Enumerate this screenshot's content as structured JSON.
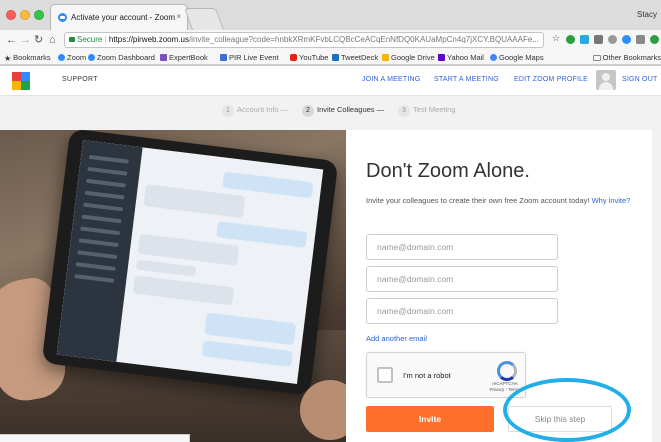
{
  "browser": {
    "tab_title": "Activate your account - Zoom",
    "tab_close": "×",
    "profile_name": "Stacy",
    "url_secure_label": "Secure",
    "url_host": "https://pirweb.zoom.us",
    "url_path": "/invite_colleague?code=hnbkXRmKFvbLCQBcCeACqEnNfDQ0KAUaMpCn4q7jXCY.BQUAAAFe...",
    "bookmarks": [
      {
        "label": "Bookmarks",
        "icon": "star-icon",
        "color": "#3a3a3a"
      },
      {
        "label": "Zoom",
        "icon": "zoom-icon",
        "color": "#2d8cff"
      },
      {
        "label": "Zoom Dashboard",
        "icon": "zoom-icon",
        "color": "#2d8cff"
      },
      {
        "label": "ExpertBook",
        "icon": "expertbook-icon",
        "color": "#7b4fbf"
      },
      {
        "label": "PIR Live Event",
        "icon": "flag-icon",
        "color": "#3b6fd6"
      },
      {
        "label": "YouTube",
        "icon": "youtube-icon",
        "color": "#e62117"
      },
      {
        "label": "TweetDeck",
        "icon": "tweetdeck-icon",
        "color": "#1c6fb8"
      },
      {
        "label": "Google Drive",
        "icon": "drive-icon",
        "color": "#f4b400"
      },
      {
        "label": "Yahoo Mail",
        "icon": "yahoo-icon",
        "color": "#5f01d1"
      },
      {
        "label": "Google Maps",
        "icon": "google-icon",
        "color": "#4285f4"
      }
    ],
    "other_bookmarks": "Other Bookmarks"
  },
  "header": {
    "support": "SUPPORT",
    "join_meeting": "JOIN A MEETING",
    "start_meeting": "START A MEETING",
    "edit_profile": "EDIT ZOOM PROFILE",
    "sign_out": "SIGN OUT"
  },
  "steps": [
    {
      "num": "1",
      "label": "Account Info —"
    },
    {
      "num": "2",
      "label": "Invite Colleagues —"
    },
    {
      "num": "3",
      "label": "Test Meeting"
    }
  ],
  "main": {
    "title": "Don't Zoom Alone.",
    "subtitle": "Invite your colleagues to create their own free Zoom account today!",
    "why_invite": "Why invite?",
    "email_placeholder": "name@domain.com",
    "add_email": "Add another email",
    "captcha_label": "I'm not a robot",
    "captcha_brand": "reCAPTCHA",
    "captcha_links": "Privacy - Terms",
    "invite_button": "Invite",
    "skip_button": "Skip this step"
  },
  "colors": {
    "accent": "#ff6f2c",
    "link": "#2d64d8",
    "highlight": "#22aee8"
  }
}
